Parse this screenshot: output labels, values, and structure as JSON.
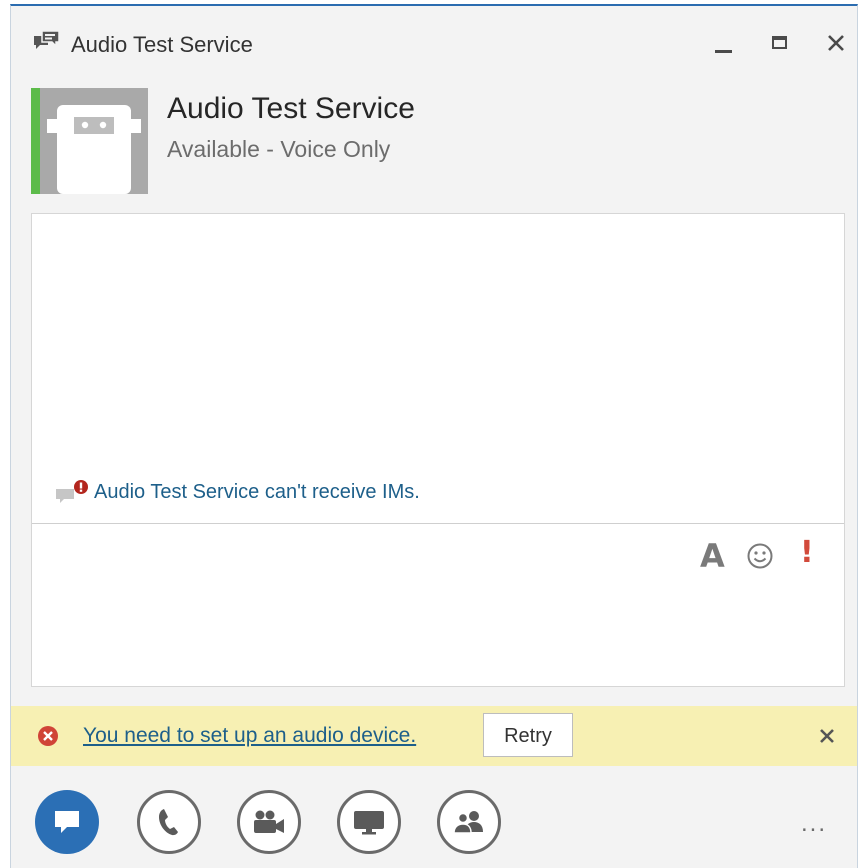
{
  "window": {
    "title": "Audio Test Service",
    "accent_color": "#2b6cb0"
  },
  "contact": {
    "name": "Audio Test Service",
    "status": "Available - Voice Only",
    "presence_color": "#5cbb4a"
  },
  "conversation": {
    "notice": "Audio Test Service can't receive IMs."
  },
  "compose": {
    "font_label": "A",
    "priority_label": "!"
  },
  "alert": {
    "message": "You need to set up an audio device.",
    "retry_label": "Retry",
    "background": "#f7f0b3"
  },
  "toolbar": {
    "items": [
      "im-icon",
      "phone-icon",
      "video-camera-icon",
      "present-screen-icon",
      "people-icon"
    ],
    "more_label": "..."
  }
}
